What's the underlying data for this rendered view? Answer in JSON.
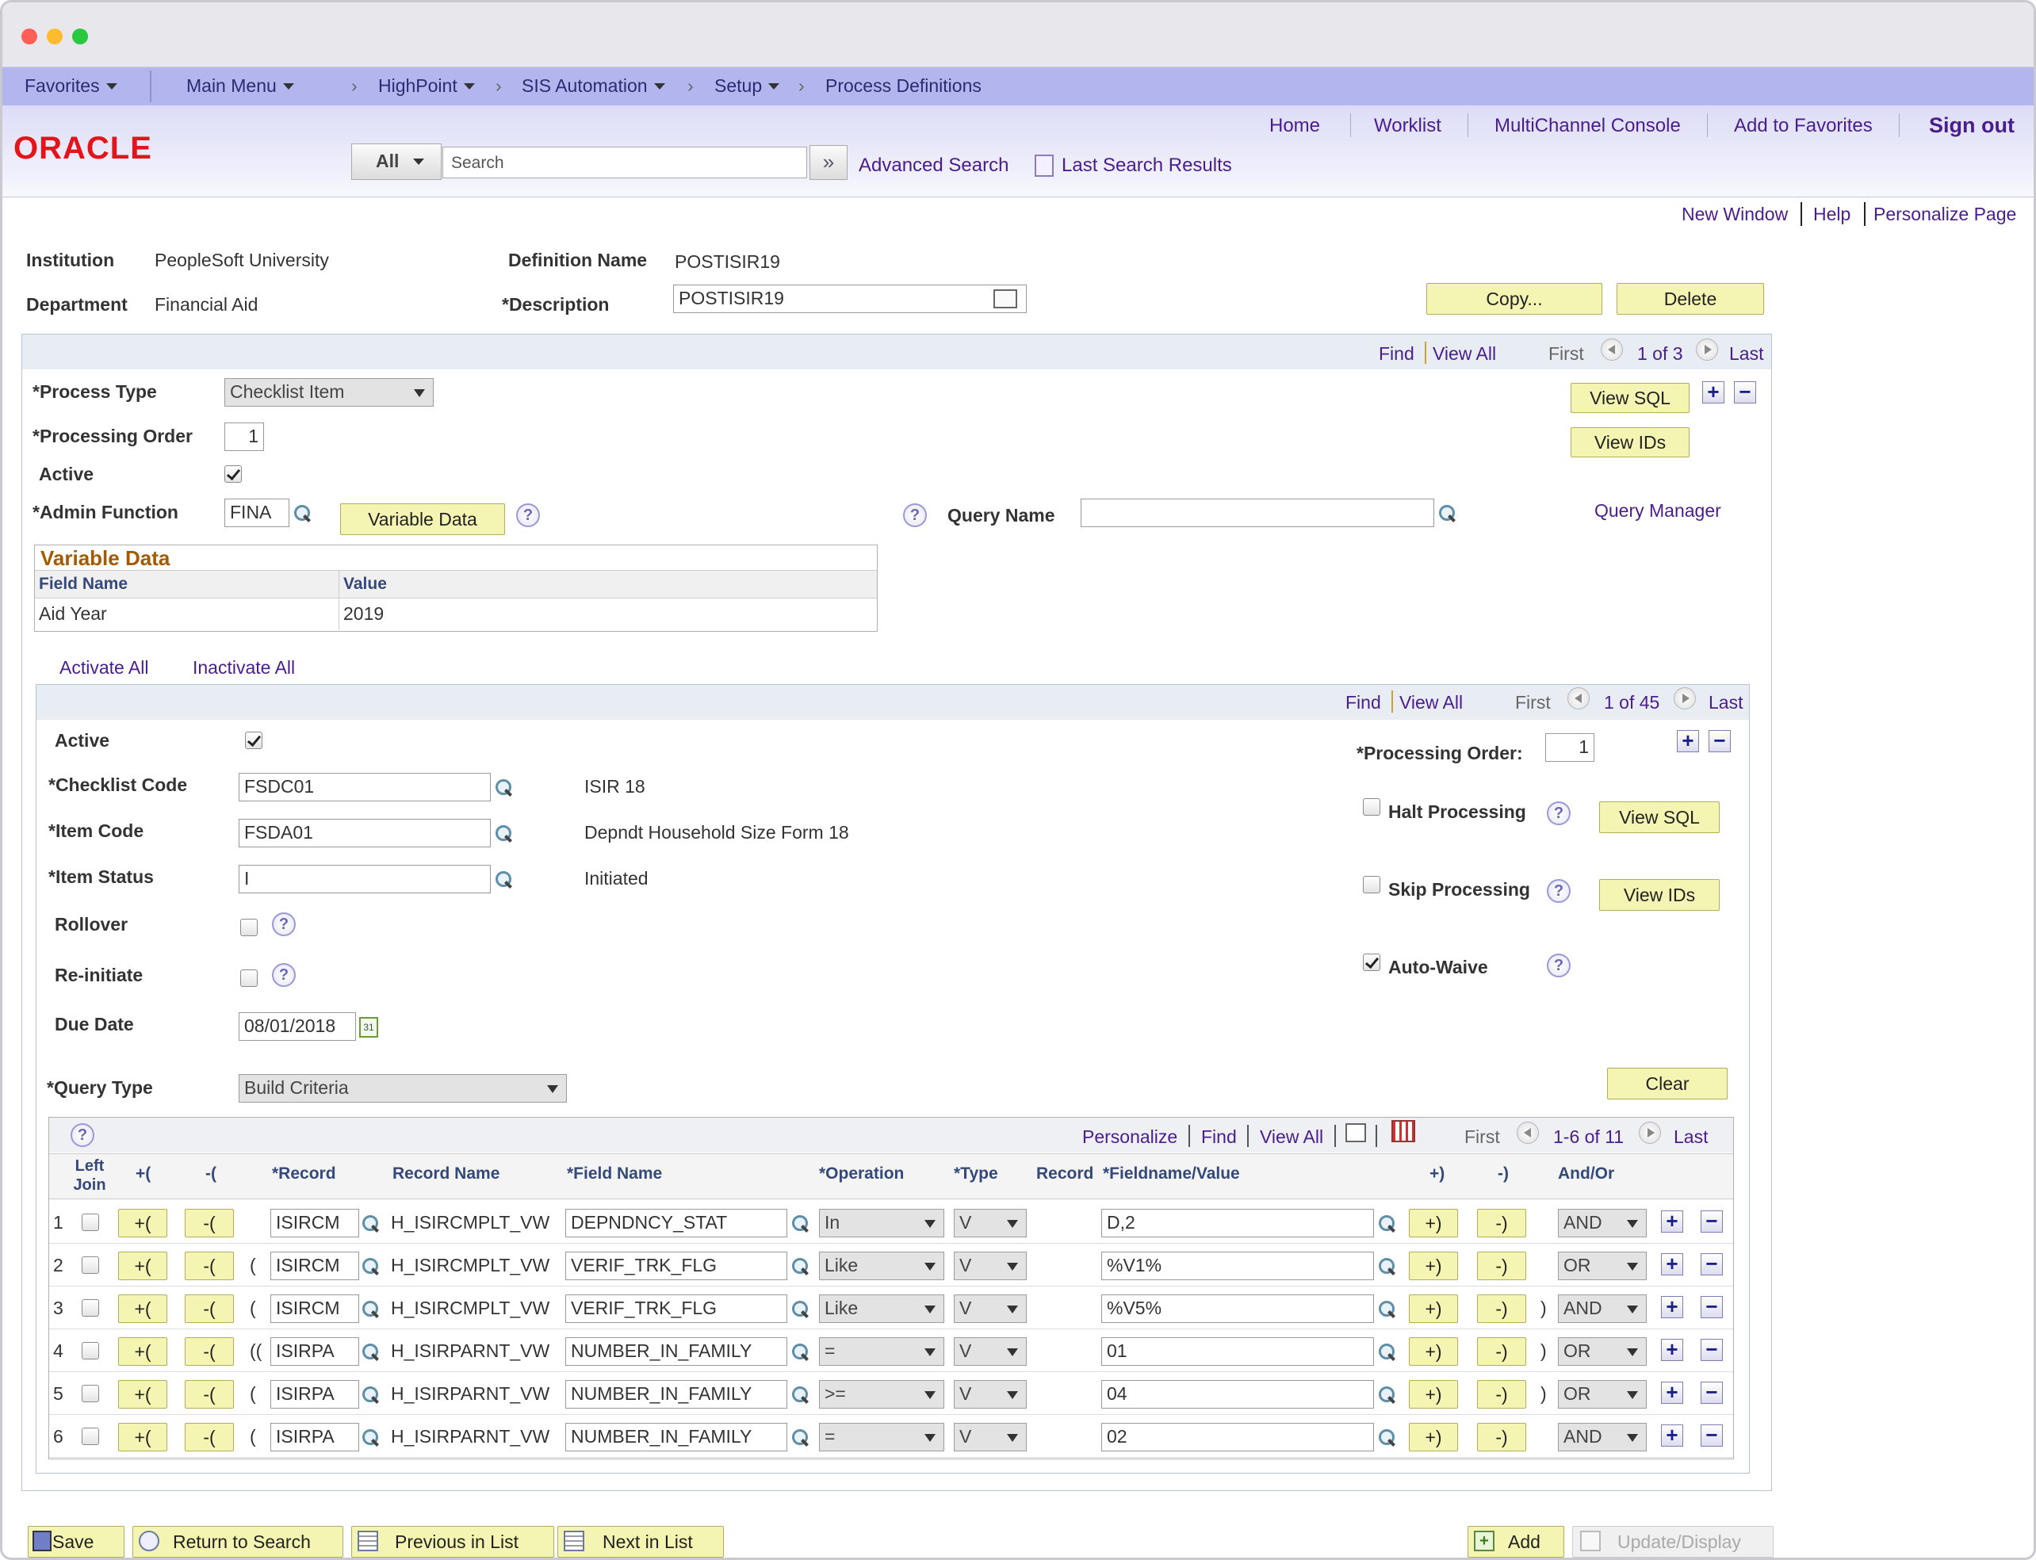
{
  "nav": {
    "favorites": "Favorites",
    "main_menu": "Main Menu",
    "highpoint": "HighPoint",
    "sis_automation": "SIS Automation",
    "setup": "Setup",
    "process_definitions": "Process Definitions"
  },
  "header": {
    "logo": "ORACLE",
    "search_scope": "All",
    "search_placeholder": "Search",
    "advanced_search": "Advanced Search",
    "last_search_results": "Last Search Results",
    "home": "Home",
    "worklist": "Worklist",
    "multichannel": "MultiChannel Console",
    "add_favorites": "Add to Favorites",
    "sign_out": "Sign out"
  },
  "toplinks": {
    "new_window": "New Window",
    "help": "Help",
    "personalize_page": "Personalize Page"
  },
  "defn": {
    "institution_label": "Institution",
    "institution_value": "PeopleSoft University",
    "department_label": "Department",
    "department_value": "Financial Aid",
    "defname_label": "Definition Name",
    "defname_value": "POSTISIR19",
    "description_label": "*Description",
    "description_value": "POSTISIR19",
    "copy_button": "Copy...",
    "delete_button": "Delete"
  },
  "nav1": {
    "find": "Find",
    "view_all": "View All",
    "first": "First",
    "count": "1 of 3",
    "last": "Last"
  },
  "process": {
    "type_label": "*Process Type",
    "type_value": "Checklist Item",
    "order_label": "*Processing Order",
    "order_value": "1",
    "active_label": "Active",
    "admin_label": "*Admin Function",
    "admin_value": "FINA",
    "variable_data_button": "Variable Data",
    "query_name_label": "Query Name",
    "query_name_value": "",
    "query_manager": "Query Manager",
    "view_sql": "View SQL",
    "view_ids": "View IDs"
  },
  "variable_data": {
    "title": "Variable Data",
    "col_field": "Field Name",
    "col_value": "Value",
    "rows": [
      {
        "field": "Aid Year",
        "value": "2019"
      }
    ]
  },
  "activate_all": "Activate All",
  "inactivate_all": "Inactivate All",
  "nav2": {
    "find": "Find",
    "view_all": "View All",
    "first": "First",
    "count": "1 of 45",
    "last": "Last"
  },
  "item": {
    "active_label": "Active",
    "checklist_label": "*Checklist Code",
    "checklist_value": "FSDC01",
    "checklist_desc": "ISIR 18",
    "item_code_label": "*Item Code",
    "item_code_value": "FSDA01",
    "item_code_desc": "Depndt Household Size Form 18",
    "status_label": "*Item Status",
    "status_value": "I",
    "status_desc": "Initiated",
    "rollover_label": "Rollover",
    "reinitiate_label": "Re-initiate",
    "due_label": "Due Date",
    "due_value": "08/01/2018",
    "query_type_label": "*Query Type",
    "query_type_value": "Build Criteria",
    "proc_order_label": "*Processing Order:",
    "proc_order_value": "1",
    "halt_label": "Halt Processing",
    "skip_label": "Skip Processing",
    "autowaive_label": "Auto-Waive",
    "view_sql": "View SQL",
    "view_ids": "View IDs",
    "clear": "Clear"
  },
  "grid": {
    "personalize": "Personalize",
    "find": "Find",
    "view_all": "View All",
    "first": "First",
    "count": "1-6 of 11",
    "last": "Last",
    "headers": {
      "left_join": "Left Join",
      "open": "+(",
      "close_paren": "-(",
      "record": "*Record",
      "record_name": "Record Name",
      "field_name": "*Field Name",
      "operation": "*Operation",
      "type": "*Type",
      "record2": "Record",
      "fieldvalue": "*Fieldname/Value",
      "rp_add": "+)",
      "rp_del": "-)",
      "andor": "And/Or"
    },
    "btn_open": "+(",
    "btn_close": "-(",
    "btn_rp_add": "+)",
    "btn_rp_del": "-)",
    "rows": [
      {
        "n": "1",
        "lp": "",
        "record": "ISIRCM",
        "record_name": "H_ISIRCMPLT_VW",
        "field": "DEPNDNCY_STAT",
        "op": "In",
        "type": "V",
        "value": "D,2",
        "rp": "",
        "andor": "AND"
      },
      {
        "n": "2",
        "lp": "(",
        "record": "ISIRCM",
        "record_name": "H_ISIRCMPLT_VW",
        "field": "VERIF_TRK_FLG",
        "op": "Like",
        "type": "V",
        "value": "%V1%",
        "rp": "",
        "andor": "OR"
      },
      {
        "n": "3",
        "lp": "(",
        "record": "ISIRCM",
        "record_name": "H_ISIRCMPLT_VW",
        "field": "VERIF_TRK_FLG",
        "op": "Like",
        "type": "V",
        "value": "%V5%",
        "rp": ")",
        "andor": "AND"
      },
      {
        "n": "4",
        "lp": "((",
        "record": "ISIRPA",
        "record_name": "H_ISIRPARNT_VW",
        "field": "NUMBER_IN_FAMILY",
        "op": "=",
        "type": "V",
        "value": "01",
        "rp": ")",
        "andor": "OR"
      },
      {
        "n": "5",
        "lp": "(",
        "record": "ISIRPA",
        "record_name": "H_ISIRPARNT_VW",
        "field": "NUMBER_IN_FAMILY",
        "op": ">=",
        "type": "V",
        "value": "04",
        "rp": ")",
        "andor": "OR"
      },
      {
        "n": "6",
        "lp": "(",
        "record": "ISIRPA",
        "record_name": "H_ISIRPARNT_VW",
        "field": "NUMBER_IN_FAMILY",
        "op": "=",
        "type": "V",
        "value": "02",
        "rp": "",
        "andor": "AND"
      }
    ]
  },
  "footer": {
    "save": "Save",
    "return_search": "Return to Search",
    "previous": "Previous in List",
    "next": "Next in List",
    "add": "Add",
    "update": "Update/Display"
  },
  "colors": {
    "nav_bg": "#b3b6ee",
    "link": "#4a1d8e",
    "button_bg": "#f5f5b3",
    "oracle_red": "#e3141b"
  }
}
